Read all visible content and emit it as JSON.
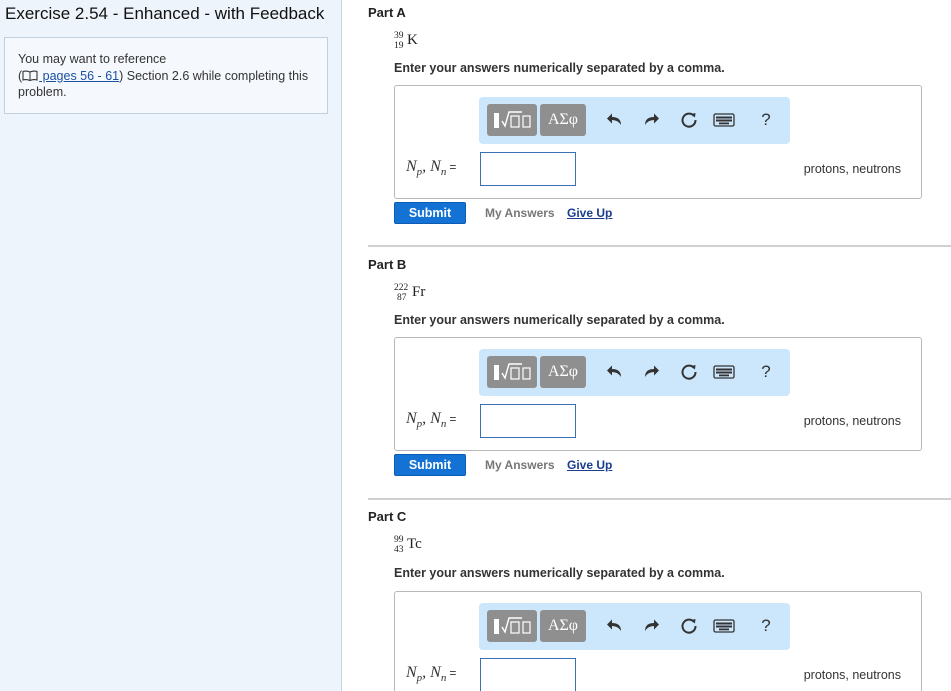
{
  "sidebar": {
    "title": "Exercise 2.54 - Enhanced - with Feedback",
    "reference": {
      "prefix": "You may want to reference",
      "open_paren": "(",
      "link_text": " pages 56 - 61",
      "suffix": ") Section 2.6 while completing this problem."
    }
  },
  "toolbar": {
    "greek_label": "ΑΣφ",
    "help_label": "?",
    "icons": [
      "templates-icon",
      "greek-letters-icon",
      "undo-icon",
      "redo-icon",
      "reset-icon",
      "keyboard-icon",
      "help-icon"
    ]
  },
  "common": {
    "instruction": "Enter your answers numerically separated by a comma.",
    "eq_np": "N",
    "eq_p": "p",
    "eq_comma": ", ",
    "eq_nn": "N",
    "eq_n": "n",
    "eq_equals": "=",
    "units": "protons, neutrons",
    "submit_label": "Submit",
    "my_answers_label": "My Answers",
    "give_up_label": "Give Up"
  },
  "parts": [
    {
      "title": "Part A",
      "isotope": {
        "mass": "39",
        "atomic": "19",
        "symbol": "K"
      },
      "answer_value": ""
    },
    {
      "title": "Part B",
      "isotope": {
        "mass": "222",
        "atomic": "87",
        "symbol": "Fr"
      },
      "answer_value": ""
    },
    {
      "title": "Part C",
      "isotope": {
        "mass": "99",
        "atomic": "43",
        "symbol": "Tc"
      },
      "answer_value": ""
    }
  ]
}
